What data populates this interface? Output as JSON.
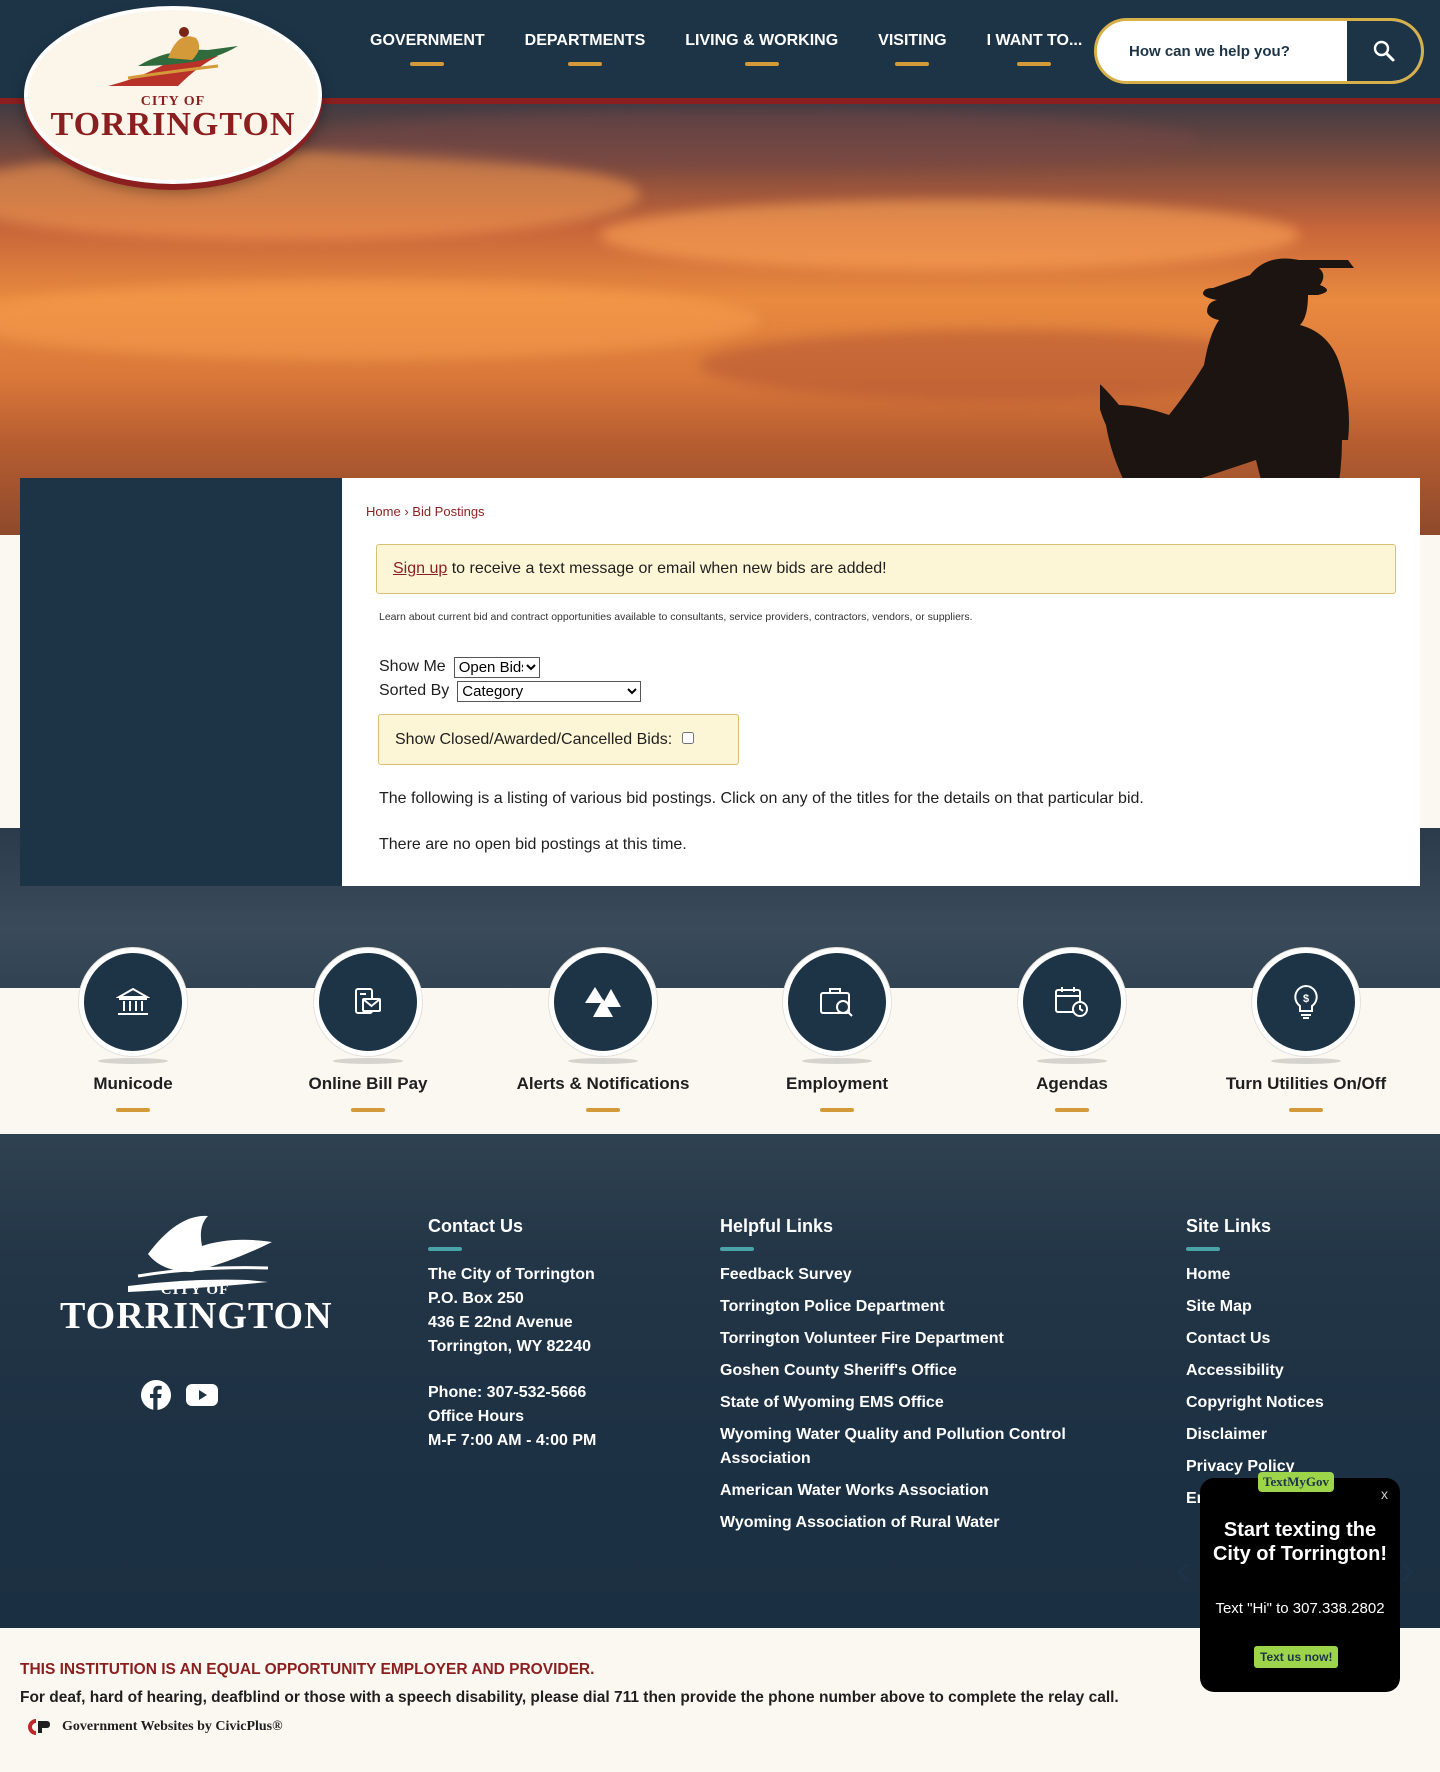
{
  "logo": {
    "city_of": "CITY OF",
    "name": "TORRINGTON"
  },
  "nav": [
    "GOVERNMENT",
    "DEPARTMENTS",
    "LIVING & WORKING",
    "VISITING",
    "I WANT TO..."
  ],
  "search": {
    "placeholder": "How can we help you?",
    "icon": "search-icon"
  },
  "breadcrumb": {
    "home": "Home",
    "sep": "›",
    "current": "Bid Postings"
  },
  "signup": {
    "link": "Sign up",
    "text": " to receive a text message or email when new bids are added!"
  },
  "intro": "Learn about current bid and contract opportunities available to consultants, service providers, contractors, vendors, or suppliers.",
  "filters": {
    "show_me_label": "Show Me",
    "show_me_value": "Open Bids",
    "sorted_by_label": "Sorted By",
    "sorted_by_value": "Category"
  },
  "closed_label": "Show Closed/Awarded/Cancelled Bids:",
  "listing_text": "The following is a listing of various bid postings. Click on any of the titles for the details on that particular bid.",
  "no_bids_text": "There are no open bid postings at this time.",
  "quick_links": [
    {
      "label": "Municode",
      "icon": "courthouse-icon"
    },
    {
      "label": "Online Bill Pay",
      "icon": "bill-pay-icon"
    },
    {
      "label": "Alerts & Notifications",
      "icon": "alerts-icon"
    },
    {
      "label": "Employment",
      "icon": "briefcase-search-icon"
    },
    {
      "label": "Agendas",
      "icon": "calendar-clock-icon"
    },
    {
      "label": "Turn Utilities On/Off",
      "icon": "lightbulb-dollar-icon"
    }
  ],
  "footer": {
    "logo": {
      "city_of": "CITY OF",
      "name": "TORRINGTON"
    },
    "contact": {
      "title": "Contact Us",
      "org": "The City of Torrington",
      "po": "P.O. Box 250",
      "street": "436 E 22nd Avenue",
      "citystate": "Torrington, WY 82240",
      "phone": "Phone: 307-532-5666",
      "hours_label": "Office Hours",
      "hours": "M-F 7:00 AM - 4:00 PM"
    },
    "helpful": {
      "title": "Helpful Links",
      "links": [
        "Feedback Survey",
        "Torrington Police Department",
        "Torrington Volunteer Fire Department",
        "Goshen County Sheriff's Office",
        "State of Wyoming EMS Office",
        "Wyoming Water Quality and Pollution Control Association",
        "American Water Works Association",
        "Wyoming Association of Rural Water"
      ]
    },
    "site": {
      "title": "Site Links",
      "links": [
        "Home",
        "Site Map",
        "Contact Us",
        "Accessibility",
        "Copyright Notices",
        "Disclaimer",
        "Privacy Policy",
        "Er"
      ]
    }
  },
  "bottom": {
    "eoe": "THIS INSTITUTION IS AN EQUAL OPPORTUNITY EMPLOYER AND PROVIDER.",
    "relay": "For deaf, hard of hearing, deafblind or those with a speech disability, please dial 711 then provide the phone number above to complete the relay call.",
    "civicplus": "Government Websites by CivicPlus®"
  },
  "textmygov": {
    "tag": "TextMyGov",
    "close": "x",
    "headline": "Start texting the City of Torrington!",
    "text": "Text \"Hi\" to 307.338.2802",
    "button": "Text us now!",
    "prev": "‹",
    "next": "›"
  },
  "colors": {
    "navy": "#1d3447",
    "maroon": "#8b1f1f",
    "gold": "#d49a3a",
    "teal": "#4aa3a8",
    "cream": "#fbf8f2"
  }
}
